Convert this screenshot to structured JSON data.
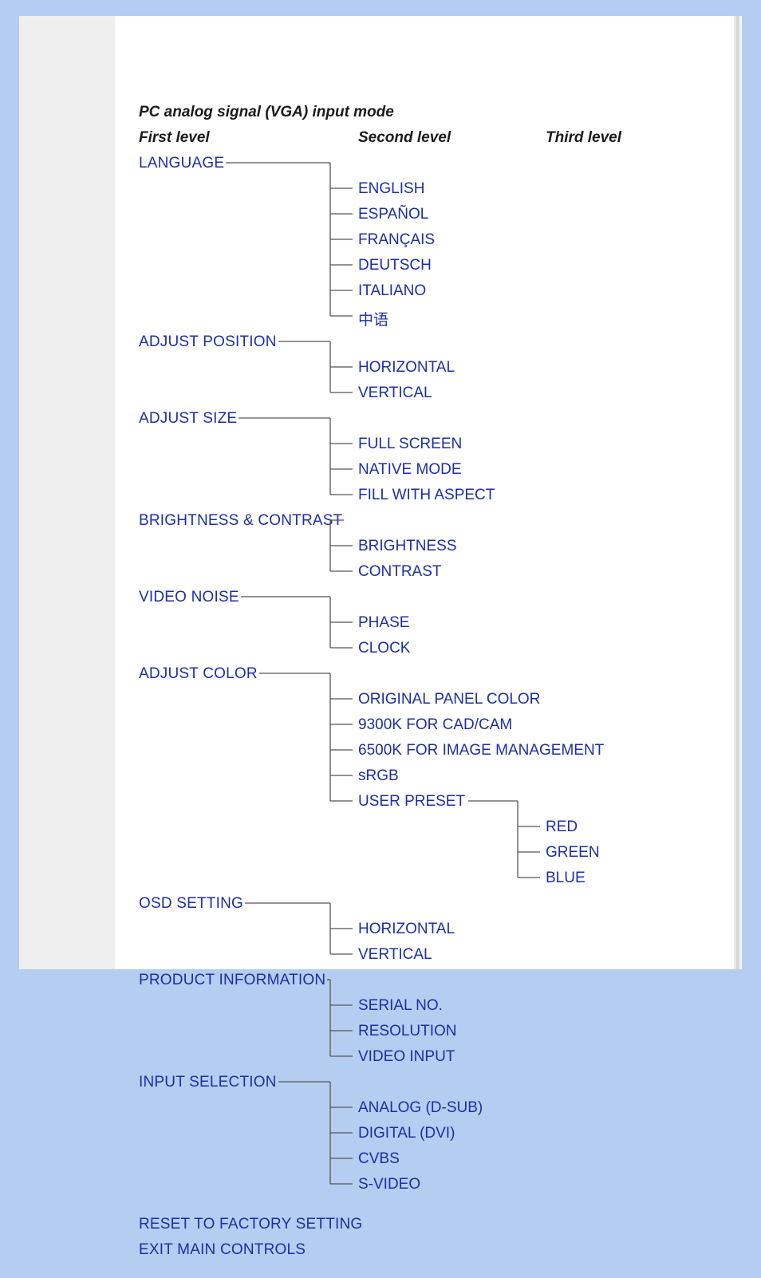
{
  "title": "PC analog signal (VGA) input mode",
  "headers": {
    "c1": "First level",
    "c2": "Second level",
    "c3": "Third level"
  },
  "tree": [
    {
      "label": "LANGUAGE",
      "children": [
        {
          "label": "ENGLISH"
        },
        {
          "label": "ESPAÑOL"
        },
        {
          "label": "FRANÇAIS"
        },
        {
          "label": "DEUTSCH"
        },
        {
          "label": "ITALIANO"
        },
        {
          "label": "中语"
        }
      ]
    },
    {
      "label": "ADJUST POSITION",
      "children": [
        {
          "label": "HORIZONTAL"
        },
        {
          "label": "VERTICAL"
        }
      ]
    },
    {
      "label": "ADJUST SIZE",
      "children": [
        {
          "label": "FULL SCREEN"
        },
        {
          "label": "NATIVE MODE"
        },
        {
          "label": "FILL WITH ASPECT"
        }
      ]
    },
    {
      "label": "BRIGHTNESS & CONTRAST",
      "children": [
        {
          "label": "BRIGHTNESS"
        },
        {
          "label": "CONTRAST"
        }
      ]
    },
    {
      "label": "VIDEO NOISE",
      "children": [
        {
          "label": "PHASE"
        },
        {
          "label": "CLOCK"
        }
      ]
    },
    {
      "label": "ADJUST COLOR",
      "children": [
        {
          "label": "ORIGINAL PANEL COLOR"
        },
        {
          "label": "9300K FOR CAD/CAM"
        },
        {
          "label": "6500K FOR IMAGE MANAGEMENT"
        },
        {
          "label": "sRGB"
        },
        {
          "label": "USER PRESET",
          "children": [
            {
              "label": "RED"
            },
            {
              "label": "GREEN"
            },
            {
              "label": "BLUE"
            }
          ]
        }
      ]
    },
    {
      "label": "OSD SETTING",
      "children": [
        {
          "label": "HORIZONTAL"
        },
        {
          "label": "VERTICAL"
        }
      ]
    },
    {
      "label": "PRODUCT INFORMATION",
      "children": [
        {
          "label": "SERIAL NO."
        },
        {
          "label": "RESOLUTION"
        },
        {
          "label": "VIDEO INPUT"
        }
      ]
    },
    {
      "label": "INPUT SELECTION",
      "children": [
        {
          "label": "ANALOG (D-SUB)"
        },
        {
          "label": "DIGITAL (DVI)"
        },
        {
          "label": "CVBS"
        },
        {
          "label": "S-VIDEO"
        }
      ]
    },
    {
      "label": "RESET TO FACTORY SETTING"
    },
    {
      "label": "EXIT MAIN CONTROLS"
    }
  ]
}
